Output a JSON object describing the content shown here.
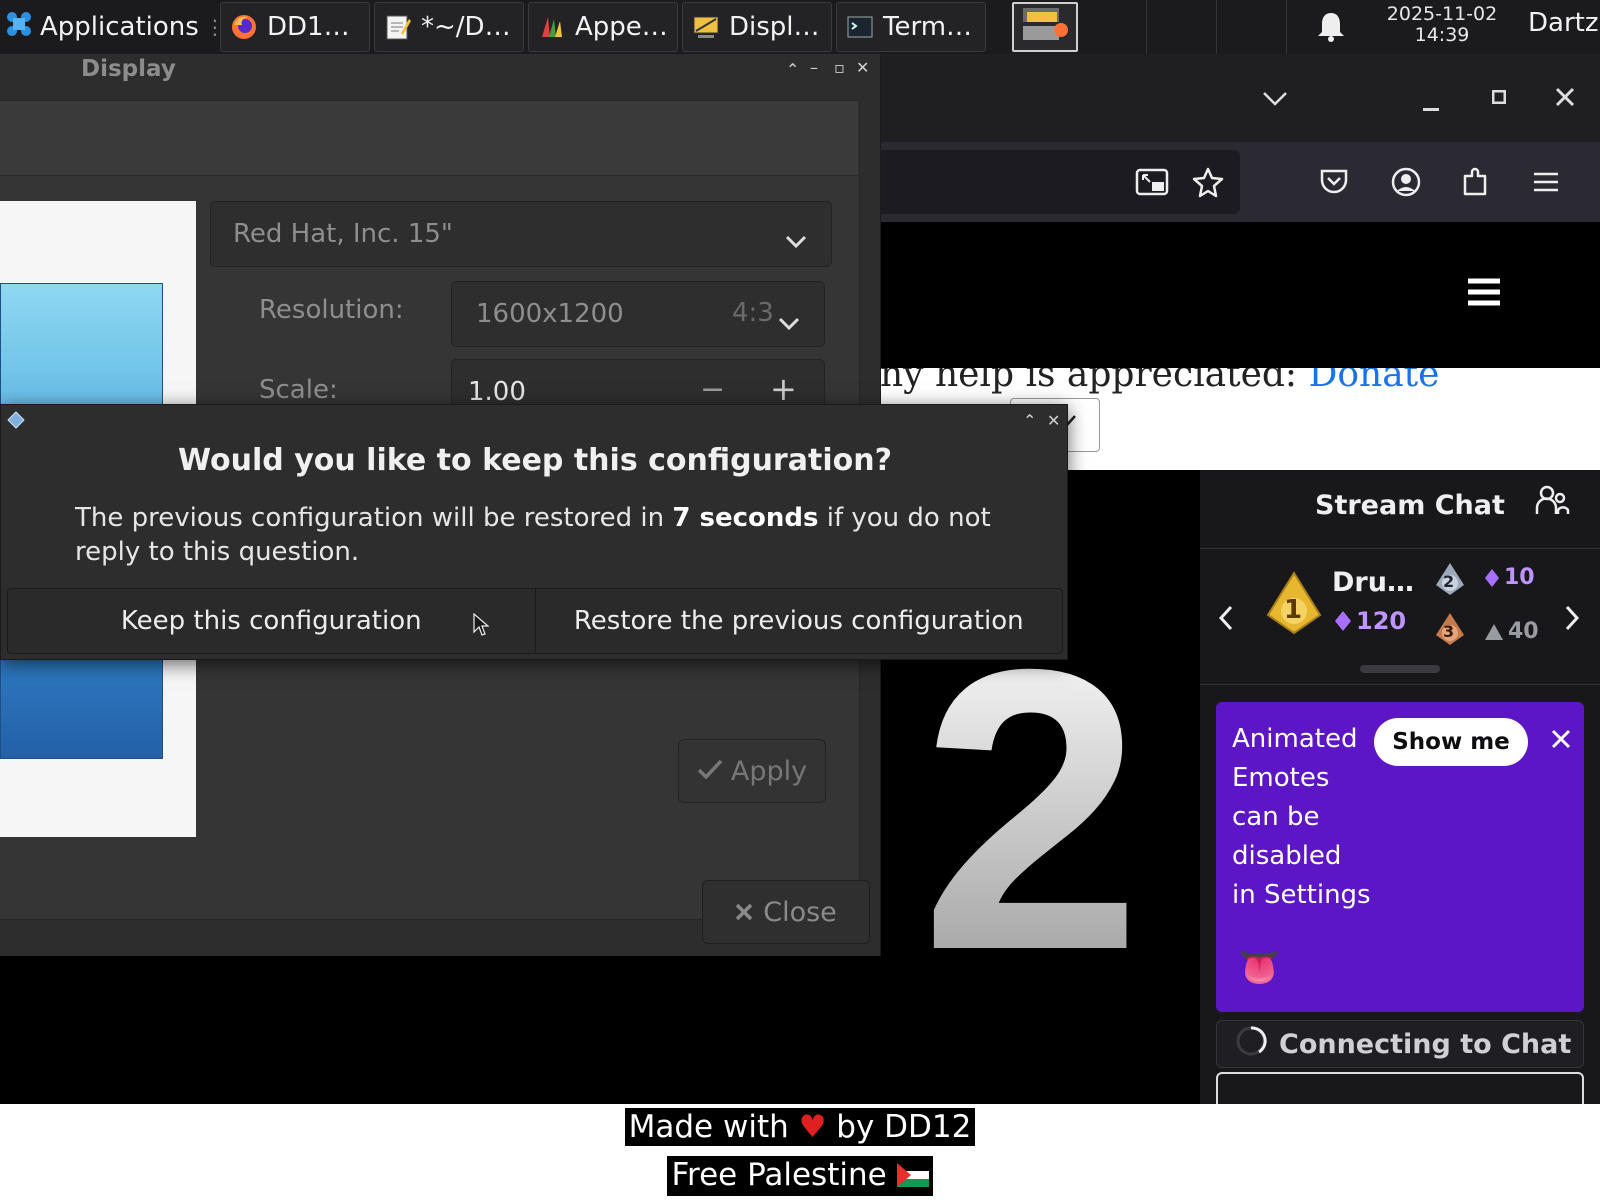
{
  "taskbar": {
    "applications_label": "Applications",
    "tasks": [
      {
        "label": "DD1…",
        "icon": "firefox-icon"
      },
      {
        "label": "*~/D…",
        "icon": "text-editor-icon"
      },
      {
        "label": "Appe…",
        "icon": "appearance-icon"
      },
      {
        "label": "Displ…",
        "icon": "display-icon"
      },
      {
        "label": "Term…",
        "icon": "terminal-icon"
      }
    ],
    "date": "2025-11-02",
    "time": "14:39",
    "user": "Dartz"
  },
  "display_window": {
    "title": "Display",
    "monitor_select": "Red Hat, Inc. 15\"",
    "resolution_label": "Resolution:",
    "resolution_value": "1600x1200",
    "aspect_ratio": "4:3",
    "scale_label": "Scale:",
    "scale_value": "1.00",
    "apply_label": "Apply",
    "close_label": "Close"
  },
  "dialog": {
    "heading": "Would you like to keep this configuration?",
    "text_before": "The previous configuration will be restored in ",
    "countdown": "7 seconds",
    "text_after": " if you do not reply to this question.",
    "keep_label": "Keep this configuration",
    "restore_label": "Restore the previous configuration"
  },
  "website": {
    "help_text": "ny help is appreciated: ",
    "donate_link": "Donate",
    "video_number": "2"
  },
  "chat": {
    "title": "Stream Chat",
    "leaderboard": {
      "first_name": "Dru…",
      "first_points": "120",
      "rank1": "1",
      "rank2": "2",
      "rank3": "3",
      "second_points": "10",
      "third_points": "40"
    },
    "promo_text": "Animated Emotes can be disabled in Settings",
    "show_me_label": "Show me",
    "connecting_label": "Connecting to Chat",
    "accent_color": "#5c16c5"
  },
  "footer": {
    "made_with_prefix": "Made with",
    "made_with_suffix": "by DD12",
    "free_palestine": "Free Palestine"
  }
}
